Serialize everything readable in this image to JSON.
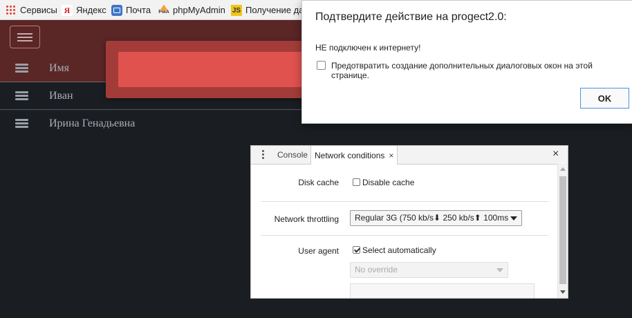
{
  "bookmarks": [
    {
      "label": "Сервисы",
      "icon": "apps-grid-icon"
    },
    {
      "label": "Яндекс",
      "icon": "yandex-icon",
      "glyph": "Я"
    },
    {
      "label": "Почта",
      "icon": "mail-icon"
    },
    {
      "label": "phpMyAdmin",
      "icon": "phpmyadmin-icon",
      "glyph": "PMA"
    },
    {
      "label": "Получение дан",
      "icon": "js-icon",
      "glyph": "JS"
    }
  ],
  "app": {
    "table_header": "Имя",
    "rows": [
      "Иван",
      "Ирина Генадьевна"
    ],
    "colors": {
      "header": "#5a2626",
      "background": "#1a1e22",
      "alert": "#e0524e"
    }
  },
  "dialog": {
    "title": "Подтвердите действие на progect2.0:",
    "message": "НЕ подключен к интернету!",
    "checkbox_label": "Предотвратить создание дополнительных диалоговых окон на этой странице.",
    "checkbox_checked": false,
    "ok_label": "OK"
  },
  "devtools": {
    "tabs": [
      {
        "label": "Console",
        "active": false
      },
      {
        "label": "Network conditions",
        "active": true,
        "close": "×"
      }
    ],
    "close": "×",
    "disk_cache": {
      "label": "Disk cache",
      "option": "Disable cache",
      "checked": false
    },
    "network_throttling": {
      "label": "Network throttling",
      "value": "Regular 3G (750 kb/s⬇ 250 kb/s⬆ 100ms"
    },
    "user_agent": {
      "label": "User agent",
      "option": "Select automatically",
      "checked": true,
      "override": "No override"
    }
  }
}
